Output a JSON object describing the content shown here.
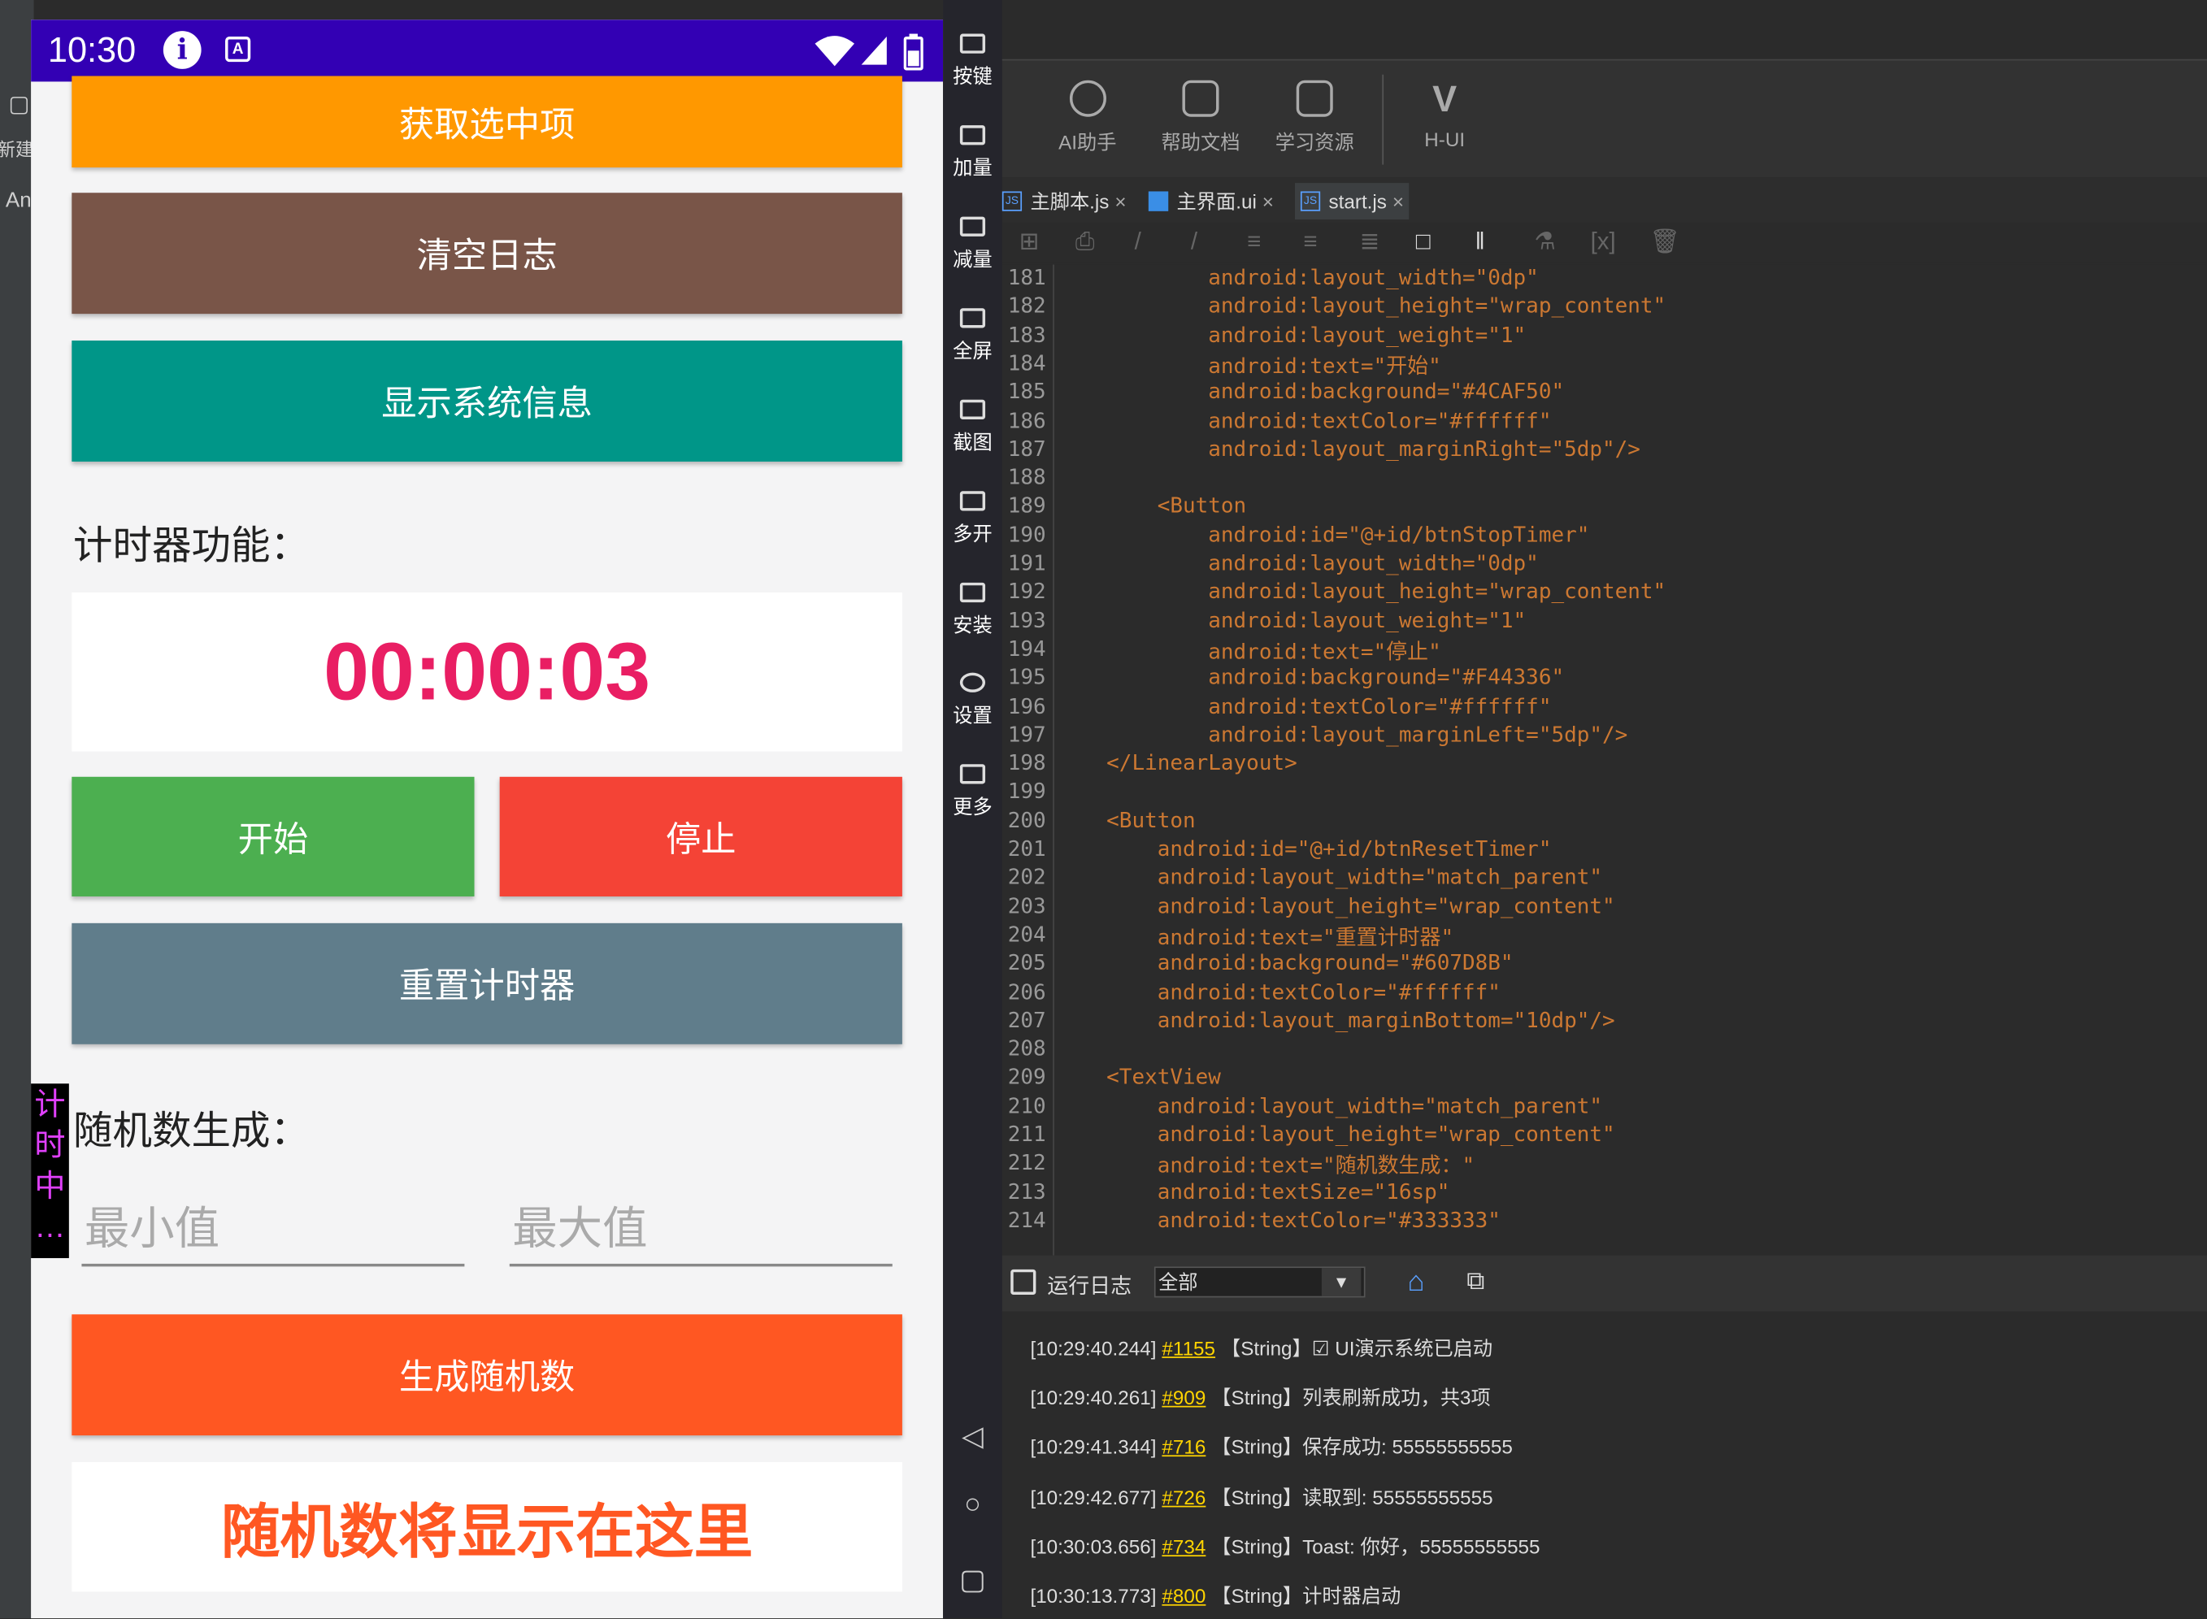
{
  "ide_left": {
    "labels": [
      "新建",
      "An"
    ]
  },
  "phone": {
    "status": {
      "time": "10:30",
      "info_icon": "i",
      "a_icon": "A"
    },
    "buttons": {
      "get_selected": "获取选中项",
      "clear_log": "清空日志",
      "show_sysinfo": "显示系统信息",
      "start": "开始",
      "stop": "停止",
      "reset_timer": "重置计时器",
      "gen_random": "生成随机数"
    },
    "colors": {
      "get_selected": "#FF9800",
      "clear_log": "#795548",
      "show_sysinfo": "#009688",
      "start": "#4CAF50",
      "stop": "#F44336",
      "reset_timer": "#607D8B",
      "gen_random": "#FF5722",
      "status_bar": "#3300B4"
    },
    "timer_label": "计时器功能：",
    "timer_value": "00:00:03",
    "random_label": "随机数生成：",
    "min_placeholder": "最小值",
    "max_placeholder": "最大值",
    "random_result": "随机数将显示在这里",
    "float_tag": "计时中..."
  },
  "emulator_bar": {
    "items": [
      "按键",
      "加量",
      "减量",
      "全屏",
      "截图",
      "多开",
      "安装",
      "设置",
      "更多"
    ],
    "nav": [
      "back-icon",
      "home-icon",
      "recent-icon"
    ]
  },
  "ide": {
    "toolbar": [
      "AI助手",
      "帮助文档",
      "学习资源",
      "H-UI"
    ],
    "tabs": [
      "主脚本.js",
      "主界面.ui",
      "start.js"
    ],
    "code_lines": [
      {
        "n": "181",
        "t": "            android:layout_width=\"0dp\""
      },
      {
        "n": "182",
        "t": "            android:layout_height=\"wrap_content\""
      },
      {
        "n": "183",
        "t": "            android:layout_weight=\"1\""
      },
      {
        "n": "184",
        "t": "            android:text=\"开始\""
      },
      {
        "n": "185",
        "t": "            android:background=\"#4CAF50\""
      },
      {
        "n": "186",
        "t": "            android:textColor=\"#ffffff\""
      },
      {
        "n": "187",
        "t": "            android:layout_marginRight=\"5dp\"/>"
      },
      {
        "n": "188",
        "t": ""
      },
      {
        "n": "189",
        "t": "        <Button"
      },
      {
        "n": "190",
        "t": "            android:id=\"@+id/btnStopTimer\""
      },
      {
        "n": "191",
        "t": "            android:layout_width=\"0dp\""
      },
      {
        "n": "192",
        "t": "            android:layout_height=\"wrap_content\""
      },
      {
        "n": "193",
        "t": "            android:layout_weight=\"1\""
      },
      {
        "n": "194",
        "t": "            android:text=\"停止\""
      },
      {
        "n": "195",
        "t": "            android:background=\"#F44336\""
      },
      {
        "n": "196",
        "t": "            android:textColor=\"#ffffff\""
      },
      {
        "n": "197",
        "t": "            android:layout_marginLeft=\"5dp\"/>"
      },
      {
        "n": "198",
        "t": "    </LinearLayout>"
      },
      {
        "n": "199",
        "t": ""
      },
      {
        "n": "200",
        "t": "    <Button"
      },
      {
        "n": "201",
        "t": "        android:id=\"@+id/btnResetTimer\""
      },
      {
        "n": "202",
        "t": "        android:layout_width=\"match_parent\""
      },
      {
        "n": "203",
        "t": "        android:layout_height=\"wrap_content\""
      },
      {
        "n": "204",
        "t": "        android:text=\"重置计时器\""
      },
      {
        "n": "205",
        "t": "        android:background=\"#607D8B\""
      },
      {
        "n": "206",
        "t": "        android:textColor=\"#ffffff\""
      },
      {
        "n": "207",
        "t": "        android:layout_marginBottom=\"10dp\"/>"
      },
      {
        "n": "208",
        "t": ""
      },
      {
        "n": "209",
        "t": "    <TextView"
      },
      {
        "n": "210",
        "t": "        android:layout_width=\"match_parent\""
      },
      {
        "n": "211",
        "t": "        android:layout_height=\"wrap_content\""
      },
      {
        "n": "212",
        "t": "        android:text=\"随机数生成：\""
      },
      {
        "n": "213",
        "t": "        android:textSize=\"16sp\""
      },
      {
        "n": "214",
        "t": "        android:textColor=\"#333333\""
      }
    ],
    "log": {
      "title": "运行日志",
      "filter": "全部",
      "lines": [
        {
          "time": "[10:29:40.244]",
          "id": "#1155",
          "msg": "【String】☑ UI演示系统已启动"
        },
        {
          "time": "[10:29:40.261]",
          "id": "#909",
          "msg": "【String】列表刷新成功，共3项"
        },
        {
          "time": "[10:29:41.344]",
          "id": "#716",
          "msg": "【String】保存成功: 55555555555"
        },
        {
          "time": "[10:29:42.677]",
          "id": "#726",
          "msg": "【String】读取到: 55555555555"
        },
        {
          "time": "[10:30:03.656]",
          "id": "#734",
          "msg": "【String】Toast: 你好，55555555555"
        },
        {
          "time": "[10:30:13.773]",
          "id": "#800",
          "msg": "【String】计时器启动"
        }
      ]
    }
  }
}
